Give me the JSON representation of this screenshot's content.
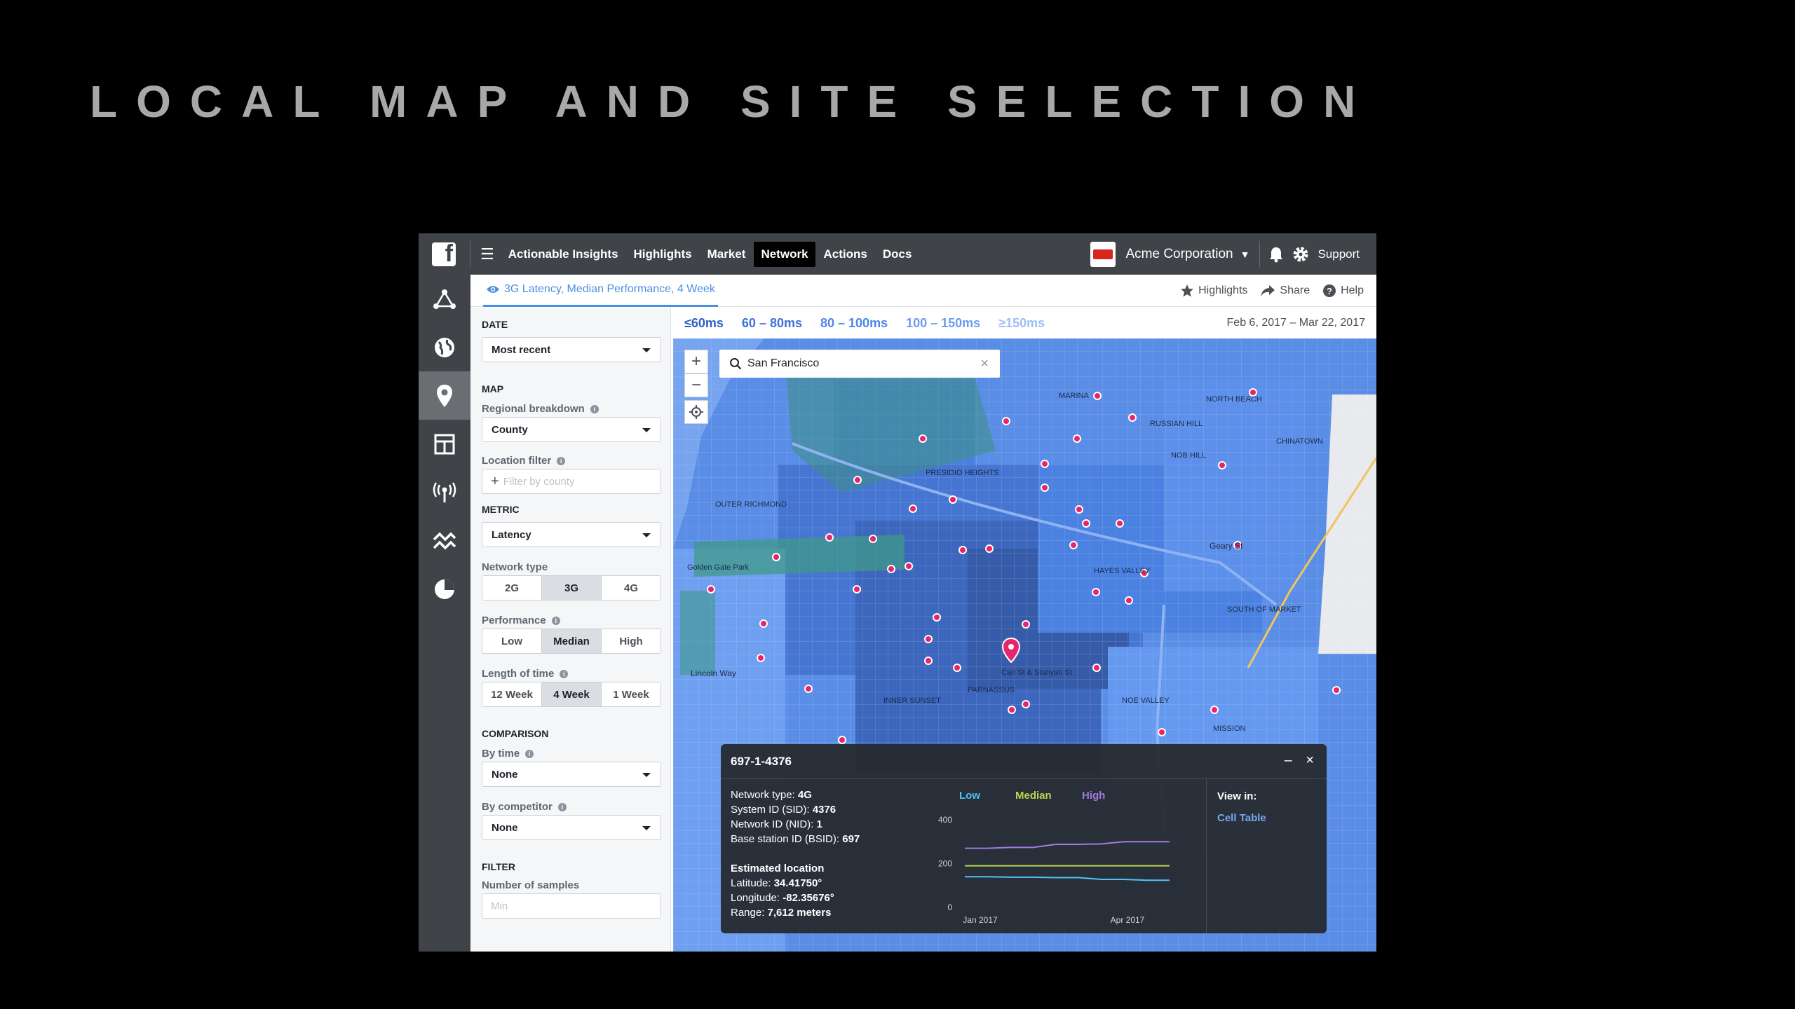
{
  "slide": {
    "title": "LOCAL MAP AND SITE SELECTION"
  },
  "topbar": {
    "logo_letter": "f",
    "nav": [
      "Actionable Insights",
      "Highlights",
      "Market",
      "Network",
      "Actions",
      "Docs"
    ],
    "active_nav": "Network",
    "company": "Acme Corporation",
    "support": "Support"
  },
  "subbar": {
    "tab": "3G Latency, Median Performance, 4 Week",
    "actions": [
      "Highlights",
      "Share",
      "Help"
    ]
  },
  "legend": {
    "items": [
      {
        "label": "≤60ms",
        "color": "#2d5fc4"
      },
      {
        "label": "60 – 80ms",
        "color": "#3f72d6"
      },
      {
        "label": "80 – 100ms",
        "color": "#4d86e8"
      },
      {
        "label": "100 – 150ms",
        "color": "#6c9cf0"
      },
      {
        "label": "≥150ms",
        "color": "#9ebdf5"
      }
    ],
    "date_range": "Feb 6, 2017 – Mar 22, 2017"
  },
  "panel": {
    "date_section": "DATE",
    "date_value": "Most recent",
    "map_section": "MAP",
    "regional_label": "Regional breakdown",
    "regional_value": "County",
    "location_label": "Location filter",
    "location_placeholder": "Filter by county",
    "metric_section": "METRIC",
    "metric_value": "Latency",
    "network_label": "Network type",
    "network_options": [
      "2G",
      "3G",
      "4G"
    ],
    "network_selected": 1,
    "performance_label": "Performance",
    "performance_options": [
      "Low",
      "Median",
      "High"
    ],
    "performance_selected": 1,
    "length_label": "Length of time",
    "length_options": [
      "12 Week",
      "4 Week",
      "1 Week"
    ],
    "length_selected": 1,
    "comparison_section": "COMPARISON",
    "bytime_label": "By time",
    "bytime_value": "None",
    "bycomp_label": "By competitor",
    "bycomp_value": "None",
    "filter_section": "FILTER",
    "samples_label": "Number of samples",
    "samples_placeholder": "Min"
  },
  "map": {
    "search_value": "San Francisco",
    "labels": [
      "Golden Gate Park",
      "OUTER RICHMOND",
      "INNER SUNSET",
      "PARNASSUS",
      "NOE VALLEY",
      "MISSION",
      "NOB HILL",
      "CHINATOWN",
      "NORTH BEACH",
      "RUSSIAN HILL",
      "MARINA",
      "PRESIDIO HEIGHTS",
      "HAYES VALLEY",
      "SOUTH OF MARKET",
      "Carl St & Stanyan St",
      "Lincoln Way",
      "Geary St"
    ]
  },
  "popup": {
    "title": "697-1-4376",
    "network_type_label": "Network type:",
    "network_type": "4G",
    "sid_label": "System ID (SID):",
    "sid": "4376",
    "nid_label": "Network ID (NID):",
    "nid": "1",
    "bsid_label": "Base station ID (BSID):",
    "bsid": "697",
    "est_location": "Estimated location",
    "lat_label": "Latitude:",
    "lat": "34.41750°",
    "lon_label": "Longitude:",
    "lon": "-82.35676°",
    "range_label": "Range:",
    "range": "7,612 meters",
    "view_in": "View in:",
    "cell_table": "Cell Table"
  },
  "chart_data": {
    "type": "line",
    "x_ticks": [
      "Jan 2017",
      "Apr 2017"
    ],
    "y_ticks": [
      0,
      200,
      400
    ],
    "ylim": [
      0,
      400
    ],
    "series": [
      {
        "name": "Low",
        "color": "#4fc3f7",
        "values": [
          140,
          140,
          138,
          138,
          136,
          136,
          128,
          128,
          124,
          124
        ]
      },
      {
        "name": "Median",
        "color": "#b9d54e",
        "values": [
          190,
          190,
          190,
          190,
          190,
          190,
          190,
          190,
          190,
          190
        ]
      },
      {
        "name": "High",
        "color": "#a07be0",
        "values": [
          270,
          270,
          274,
          274,
          288,
          288,
          290,
          300,
          300,
          300
        ]
      }
    ]
  }
}
